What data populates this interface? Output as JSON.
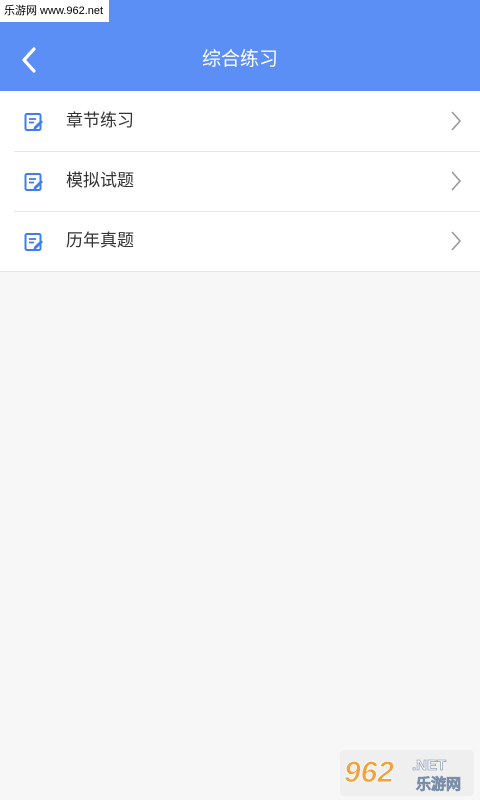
{
  "watermark_top": "乐游网 www.962.net",
  "header": {
    "title": "综合练习",
    "back_icon": "back-arrow-icon",
    "background": "#5c8ff5"
  },
  "menu": {
    "items": [
      {
        "label": "章节练习",
        "icon": "edit-document-icon"
      },
      {
        "label": "模拟试题",
        "icon": "edit-document-icon"
      },
      {
        "label": "历年真题",
        "icon": "edit-document-icon"
      }
    ]
  },
  "watermark_bottom": {
    "logo_text": "962",
    "net_text": ".NET",
    "site_text": "乐游网"
  }
}
